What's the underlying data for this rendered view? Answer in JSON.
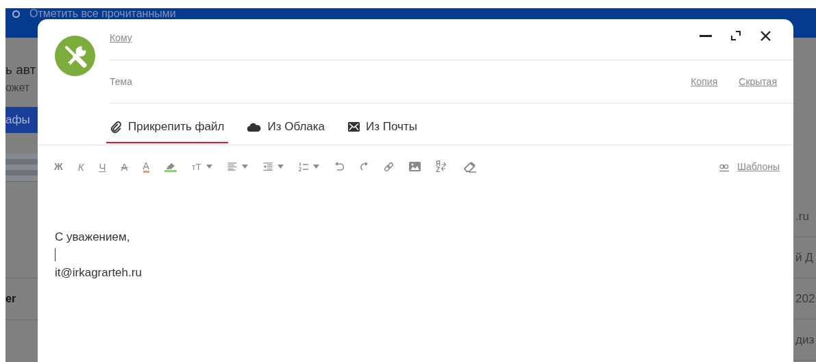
{
  "background": {
    "top_bar": {
      "action": "Отметить все прочитанными"
    },
    "left_fragments": [
      {
        "kind": "heading",
        "text": "ь авт"
      },
      {
        "kind": "note",
        "text": "ожет"
      },
      {
        "kind": "band",
        "text": "афы"
      },
      {
        "kind": "stripes"
      },
      {
        "kind": "bold",
        "text": "er"
      }
    ],
    "right_fragments": [
      ".ru",
      "й Д",
      "202",
      "диз"
    ]
  },
  "compose": {
    "to_label": "Кому",
    "subject_placeholder": "Тема",
    "cc_links": [
      "Копия",
      "Скрытая"
    ],
    "attach": [
      {
        "kind": "file",
        "label": "Прикрепить файл",
        "selected": true
      },
      {
        "kind": "cloud",
        "label": "Из Облака",
        "selected": false
      },
      {
        "kind": "mail",
        "label": "Из Почты",
        "selected": false
      }
    ],
    "toolbar": [
      {
        "kind": "bold",
        "label": "Ж"
      },
      {
        "kind": "italic",
        "label": "К"
      },
      {
        "kind": "underline",
        "label": "Ч"
      },
      {
        "kind": "strike",
        "label": "А"
      },
      {
        "kind": "color",
        "label": "А"
      },
      {
        "kind": "highlight"
      },
      {
        "kind": "size",
        "label": "тТ"
      },
      {
        "kind": "align"
      },
      {
        "kind": "indent"
      },
      {
        "kind": "list"
      },
      {
        "kind": "undo"
      },
      {
        "kind": "redo"
      },
      {
        "kind": "link"
      },
      {
        "kind": "image"
      },
      {
        "kind": "translit",
        "label": "ЯZ"
      },
      {
        "kind": "clear"
      }
    ],
    "templates": "Шаблоны",
    "body": [
      "С уважением,",
      "it@irkagrarteh.ru"
    ]
  }
}
